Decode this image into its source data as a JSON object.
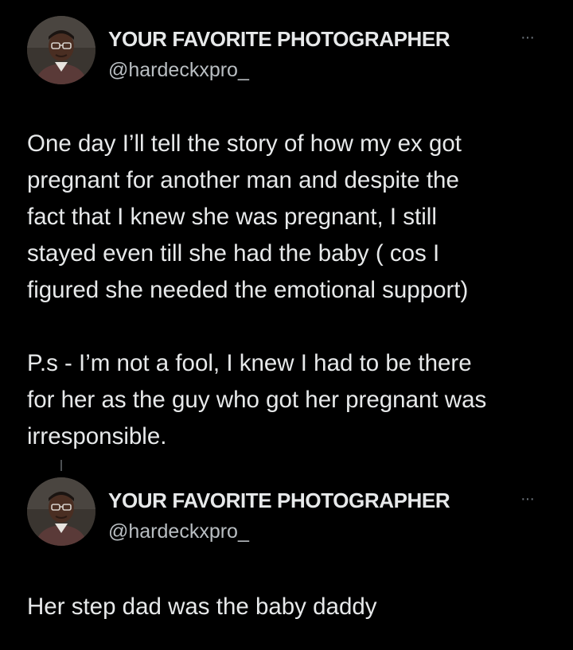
{
  "tweets": [
    {
      "display_name": "YOUR FAVORITE PHOTOGRAPHER",
      "handle": "@hardeckxpro_",
      "more_icon": "more-horizontal-icon",
      "more_glyph": "···",
      "body_lines": [
        "One day I’ll tell the story of how my ex got",
        "pregnant for another man and despite the",
        "fact that I knew she was pregnant, I still",
        "stayed even till she had the baby ( cos I",
        "figured she needed the emotional support)",
        "",
        "P.s - I’m not a fool, I knew I had to be there",
        "for her as the guy who got her pregnant was",
        "irresponsible."
      ]
    },
    {
      "display_name": "YOUR FAVORITE PHOTOGRAPHER",
      "handle": "@hardeckxpro_",
      "more_icon": "more-horizontal-icon",
      "more_glyph": "···",
      "body_lines": [
        "Her step dad was the baby daddy"
      ]
    }
  ],
  "colors": {
    "background": "#000000",
    "text_primary": "#e7e9ea",
    "text_secondary": "#b9bec2",
    "icon_muted": "#6e767d"
  }
}
